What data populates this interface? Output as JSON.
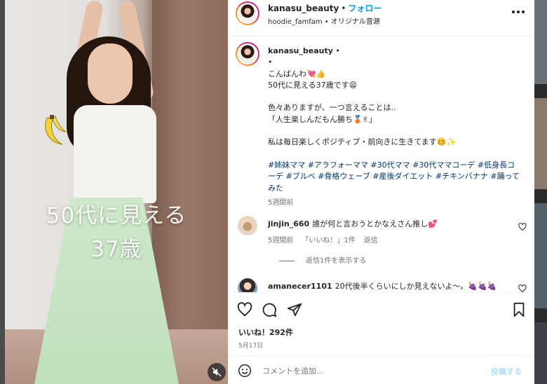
{
  "media": {
    "overlay_text": [
      "50代に見える",
      "37歳"
    ]
  },
  "header": {
    "username": "kanasu_beauty",
    "separator": "•",
    "follow_label": "フォロー",
    "audio": "hoodie_famfam • オリジナル音源"
  },
  "caption": {
    "username": "kanasu_beauty",
    "after_username": " •",
    "lines": [
      "•",
      "こんばんわ💘👍",
      "50代に見える37歳です😩",
      "",
      "色々ありますが、一つ言えることは‥",
      "「人生楽しんだもん勝ち🥉✌」",
      "",
      "私は毎日楽しくポジティブ・前向きに生きてます🥴✨",
      ""
    ],
    "hashtags": "#姉妹ママ #アラフォーママ #30代ママ #30代ママコーデ #低身長コーデ #ブルベ #骨格ウェーブ #産後ダイエット #チキンバナナ #踊ってみた",
    "time": "5週間前"
  },
  "comments": [
    {
      "username": "jinjin_660",
      "text": "誰が何と言おうとかなえさん推し💕",
      "time": "5週間前",
      "likes": "「いいね！」1件",
      "reply_label": "返信",
      "view_replies": "返信1件を表示する"
    },
    {
      "username": "amanecer1101",
      "text": "20代後半くらいにしか見えないよ〜。🍇🍇🍇"
    }
  ],
  "actions": {
    "likes": "いいね！292件",
    "date": "5月17日"
  },
  "composer": {
    "placeholder": "コメントを追加...",
    "post_label": "投稿する"
  },
  "icons": {
    "more": "more-icon",
    "like": "heart-icon",
    "comment": "comment-icon",
    "share": "send-icon",
    "save": "bookmark-icon",
    "emoji": "emoji-icon",
    "mute": "mute-icon"
  },
  "colors": {
    "accent": "#0095f6",
    "hashtag": "#00376b",
    "muted_text": "#737373",
    "post_disabled": "#b2dffc"
  }
}
